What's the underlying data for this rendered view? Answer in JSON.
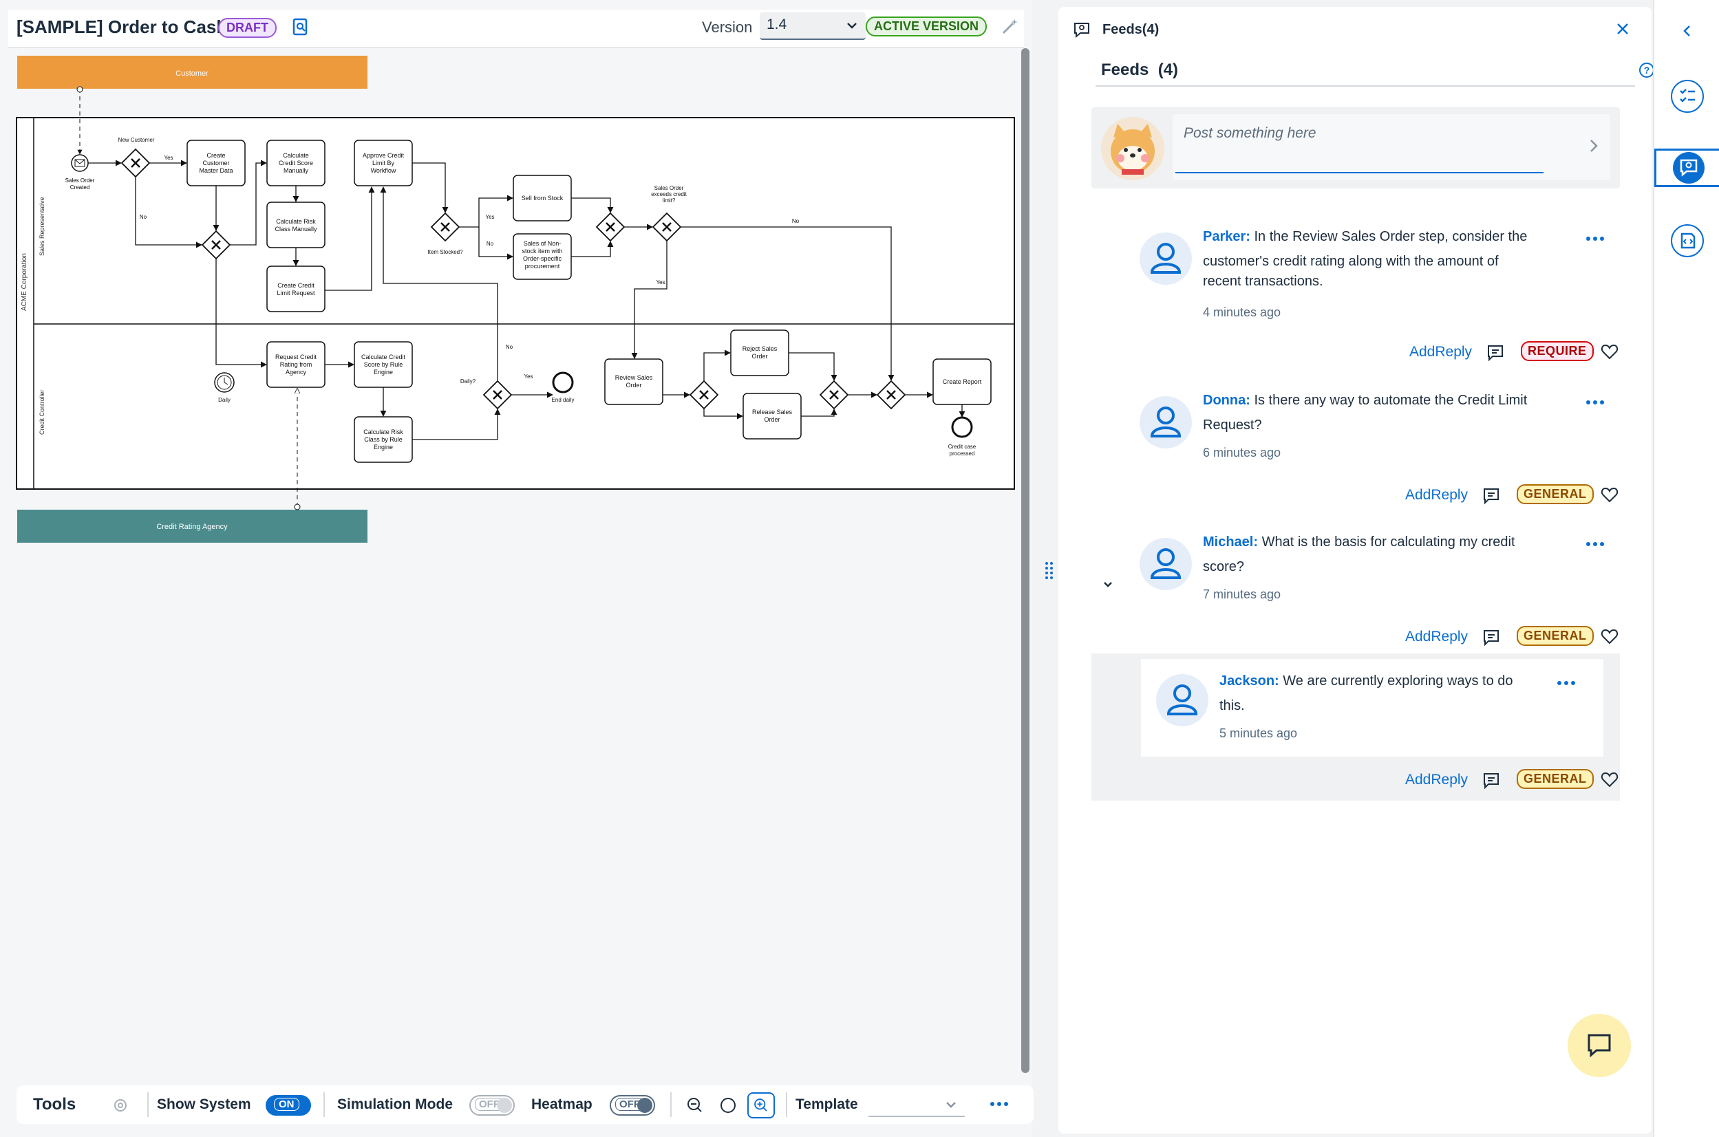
{
  "header": {
    "title": "[SAMPLE] Order to Cash",
    "draft_badge": "DRAFT",
    "version_label": "Version",
    "version_value": "1.4",
    "active_badge": "ACTIVE VERSION"
  },
  "diagram": {
    "pools": [
      "Customer",
      "Credit Rating Agency"
    ],
    "lanes": [
      "ACME Corporation",
      "Sales Representative",
      "Credit Controller"
    ],
    "labels": {
      "sales_order_created": [
        "Sales Order",
        "Created"
      ],
      "new_customer": "New Customer",
      "yes": "Yes",
      "no": "No",
      "create_customer": [
        "Create",
        "Customer",
        "Master Data"
      ],
      "calc_credit_manual": [
        "Calculate",
        "Credit Score",
        "Manually"
      ],
      "calc_risk_manual": [
        "Calculate Risk",
        "Class Manually"
      ],
      "create_credit_limit": [
        "Create Credit",
        "Limit Request"
      ],
      "approve_credit": [
        "Approve Credit",
        "Limit By",
        "Workflow"
      ],
      "item_stocked": "Item Stocked?",
      "sell_from_stock": "Sell from Stock",
      "sales_non_stock": [
        "Sales of Non-",
        "stock item with",
        "Order-specific",
        "procurement"
      ],
      "sales_order_exceeds": [
        "Sales Order",
        "exceeds credit",
        "limit?"
      ],
      "request_credit": [
        "Request Credit",
        "Rating from",
        "Agency"
      ],
      "calc_credit_rule": [
        "Calculate Credit",
        "Score by Rule",
        "Engine"
      ],
      "calc_risk_rule": [
        "Calculate Risk",
        "Class by Rule",
        "Engine"
      ],
      "daily": "Daily",
      "daily_q": "Daily?",
      "end_daily": "End daily",
      "review_sales": [
        "Review Sales",
        "Order"
      ],
      "reject_sales": [
        "Reject Sales",
        "Order"
      ],
      "release_sales": [
        "Release Sales",
        "Order"
      ],
      "create_report": "Create Report",
      "credit_case": [
        "Credit case",
        "processed"
      ]
    }
  },
  "toolbar": {
    "tools": "Tools",
    "show_system": "Show System",
    "show_system_state": "ON",
    "simulation_mode": "Simulation Mode",
    "simulation_state": "OFF",
    "heatmap": "Heatmap",
    "heatmap_state": "OFF",
    "template": "Template"
  },
  "feeds": {
    "header_title": "Feeds(4)",
    "sub_title": "Feeds  (4)",
    "post_placeholder": "Post something here",
    "items": [
      {
        "name": "Parker:",
        "text_line1": " In the Review Sales Order step, consider the",
        "text_line2": "customer's credit rating along with the amount of",
        "text_line3": "recent transactions.",
        "time": "4 minutes ago",
        "action": "AddReply",
        "tag": "REQUIRE"
      },
      {
        "name": "Donna:",
        "text_line1": " Is there any way to automate the Credit Limit",
        "text_line2": "Request?",
        "time": "6 minutes ago",
        "action": "AddReply",
        "tag": "GENERAL"
      },
      {
        "name": "Michael:",
        "text_line1": " What is the basis for calculating my credit",
        "text_line2": "score?",
        "time": "7 minutes ago",
        "action": "AddReply",
        "tag": "GENERAL"
      },
      {
        "name": "Jackson:",
        "text_line1": " We are currently exploring ways to do",
        "text_line2": "this.",
        "time": "5 minutes ago",
        "action": "AddReply",
        "tag": "GENERAL"
      }
    ]
  },
  "colors": {
    "accent": "#0a6ed1",
    "customer_pool": "#ec9a3c",
    "agency_pool": "#4b8b8c"
  },
  "icons": [
    "doc-icon",
    "chevron-down-icon",
    "magic-wand-icon",
    "close-icon",
    "help-icon",
    "send-icon",
    "more-icon",
    "comment-icon",
    "heart-icon",
    "chat-icon",
    "zoom-out-icon",
    "zoom-reset-icon",
    "zoom-in-icon",
    "collapse-left-icon",
    "tasks-icon",
    "feeds-icon",
    "code-icon"
  ]
}
